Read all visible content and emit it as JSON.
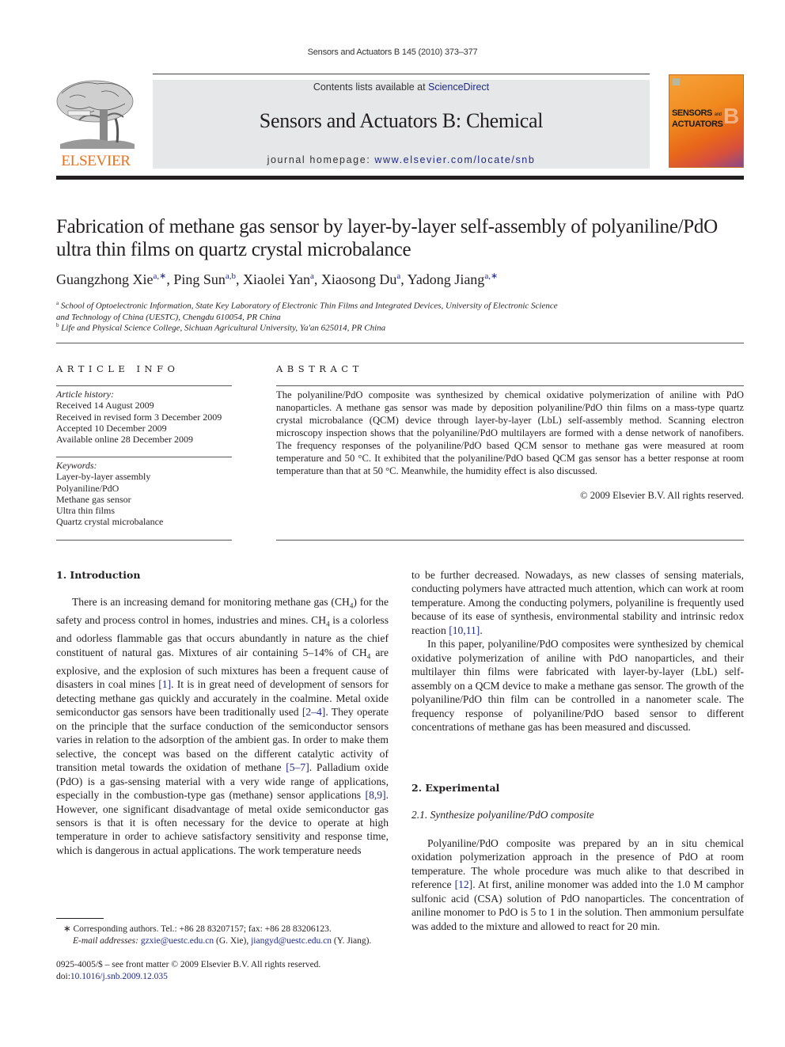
{
  "running_head": "Sensors and Actuators B 145 (2010) 373–377",
  "masthead": {
    "contents_prefix": "Contents lists available at ",
    "contents_link": "ScienceDirect",
    "journal_title": "Sensors and Actuators B: Chemical",
    "homepage_prefix": "journal homepage: ",
    "homepage_link": "www.elsevier.com/locate/snb",
    "publisher_logo_text": "ELSEVIER",
    "cover_title_line1": "SENSORS",
    "cover_title_and": "and",
    "cover_title_line2": "ACTUATORS",
    "cover_letter": "B",
    "colors": {
      "link": "#1f2a8a",
      "elsevier_orange": "#e9711c",
      "masthead_bg": "#e6e7e8"
    }
  },
  "article": {
    "title": "Fabrication of methane gas sensor by layer-by-layer self-assembly of polyaniline/PdO ultra thin films on quartz crystal microbalance",
    "authors": [
      {
        "name": "Guangzhong Xie",
        "sup": "a,∗"
      },
      {
        "name": "Ping Sun",
        "sup": "a,b"
      },
      {
        "name": "Xiaolei Yan",
        "sup": "a"
      },
      {
        "name": "Xiaosong Du",
        "sup": "a"
      },
      {
        "name": "Yadong Jiang",
        "sup": "a,∗"
      }
    ],
    "affiliations": [
      {
        "mark": "a",
        "line1": "School of Optoelectronic Information, State Key Laboratory of Electronic Thin Films and Integrated Devices, University of Electronic Science",
        "line2": "and Technology of China (UESTC), Chengdu 610054, PR China"
      },
      {
        "mark": "b",
        "line1": "Life and Physical Science College, Sichuan Agricultural University, Ya'an 625014, PR China"
      }
    ]
  },
  "article_info": {
    "heading": "ARTICLE INFO",
    "history_label": "Article history:",
    "history": [
      "Received 14 August 2009",
      "Received in revised form 3 December 2009",
      "Accepted 10 December 2009",
      "Available online 28 December 2009"
    ],
    "keywords_label": "Keywords:",
    "keywords": [
      "Layer-by-layer assembly",
      "Polyaniline/PdO",
      "Methane gas sensor",
      "Ultra thin films",
      "Quartz crystal microbalance"
    ]
  },
  "abstract": {
    "heading": "ABSTRACT",
    "text": "The polyaniline/PdO composite was synthesized by chemical oxidative polymerization of aniline with PdO nanoparticles. A methane gas sensor was made by deposition polyaniline/PdO thin films on a mass-type quartz crystal microbalance (QCM) device through layer-by-layer (LbL) self-assembly method. Scanning electron microscopy inspection shows that the polyaniline/PdO multilayers are formed with a dense network of nanofibers. The frequency responses of the polyaniline/PdO based QCM sensor to methane gas were measured at room temperature and 50 °C. It exhibited that the polyaniline/PdO based QCM gas sensor has a better response at room temperature than that at 50 °C. Meanwhile, the humidity effect is also discussed.",
    "copyright": "© 2009 Elsevier B.V. All rights reserved."
  },
  "body": {
    "intro_heading": "1.  Introduction",
    "intro_p1": [
      "There is an increasing demand for monitoring methane gas (CH",
      "4",
      ") for the safety and process control in homes, industries and mines. CH",
      "4",
      " is a colorless and odorless flammable gas that occurs abundantly in nature as the chief constituent of natural gas. Mixtures of air containing 5–14% of CH",
      "4",
      " are explosive, and the explosion of such mixtures has been a frequent cause of disasters in coal mines ",
      "[1]",
      ". It is in great need of development of sensors for detecting methane gas quickly and accurately in the coalmine. Metal oxide semiconductor gas sensors have been traditionally used ",
      "[2–4]",
      ". They operate on the principle that the surface conduction of the semiconductor sensors varies in relation to the adsorption of the ambient gas. In order to make them selective, the concept was based on the different catalytic activity of transition metal towards the oxidation of methane ",
      "[5–7]",
      ". Palladium oxide (PdO) is a gas-sensing material with a very wide range of applications, especially in the combustion-type gas (methane) sensor applications ",
      "[8,9]",
      ". However, one significant disadvantage of metal oxide semiconductor gas sensors is that it is often necessary for the device to operate at high temperature in order to achieve satisfactory sensitivity and response time, which is dangerous in actual applications. The work temperature needs"
    ],
    "right_p1": [
      "to be further decreased. Nowadays, as new classes of sensing materials, conducting polymers have attracted much attention, which can work at room temperature. Among the conducting polymers, polyaniline is frequently used because of its ease of synthesis, environmental stability and intrinsic redox reaction ",
      "[10,11]",
      "."
    ],
    "right_p2": "In this paper, polyaniline/PdO composites were synthesized by chemical oxidative polymerization of aniline with PdO nanoparticles, and their multilayer thin films were fabricated with layer-by-layer (LbL) self-assembly on a QCM device to make a methane gas sensor. The growth of the polyaniline/PdO thin film can be controlled in a nanometer scale. The frequency response of polyaniline/PdO based sensor to different concentrations of methane gas has been measured and discussed.",
    "exp_heading": "2.  Experimental",
    "exp_subheading": "2.1.  Synthesize polyaniline/PdO composite",
    "exp_p1": [
      "Polyaniline/PdO composite was prepared by an in situ chemical oxidation polymerization approach in the presence of PdO at room temperature. The whole procedure was much alike to that described in reference ",
      "[12]",
      ". At first, aniline monomer was added into the 1.0 M camphor sulfonic acid (CSA) solution of PdO nanoparticles. The concentration of aniline monomer to PdO is 5 to 1 in the solution. Then ammonium persulfate was added to the mixture and allowed to react for 20 min."
    ]
  },
  "footnotes": {
    "corresponding": "∗  Corresponding authors. Tel.: +86 28 83207157; fax: +86 28 83206123.",
    "email_label": "E-mail addresses: ",
    "email1": "gzxie@uestc.edu.cn",
    "email1_who": " (G. Xie), ",
    "email2": "jiangyd@uestc.edu.cn",
    "email2_who": " (Y. Jiang).",
    "issn_line": "0925-4005/$ – see front matter © 2009 Elsevier B.V. All rights reserved.",
    "doi_prefix": "doi:",
    "doi": "10.1016/j.snb.2009.12.035"
  }
}
